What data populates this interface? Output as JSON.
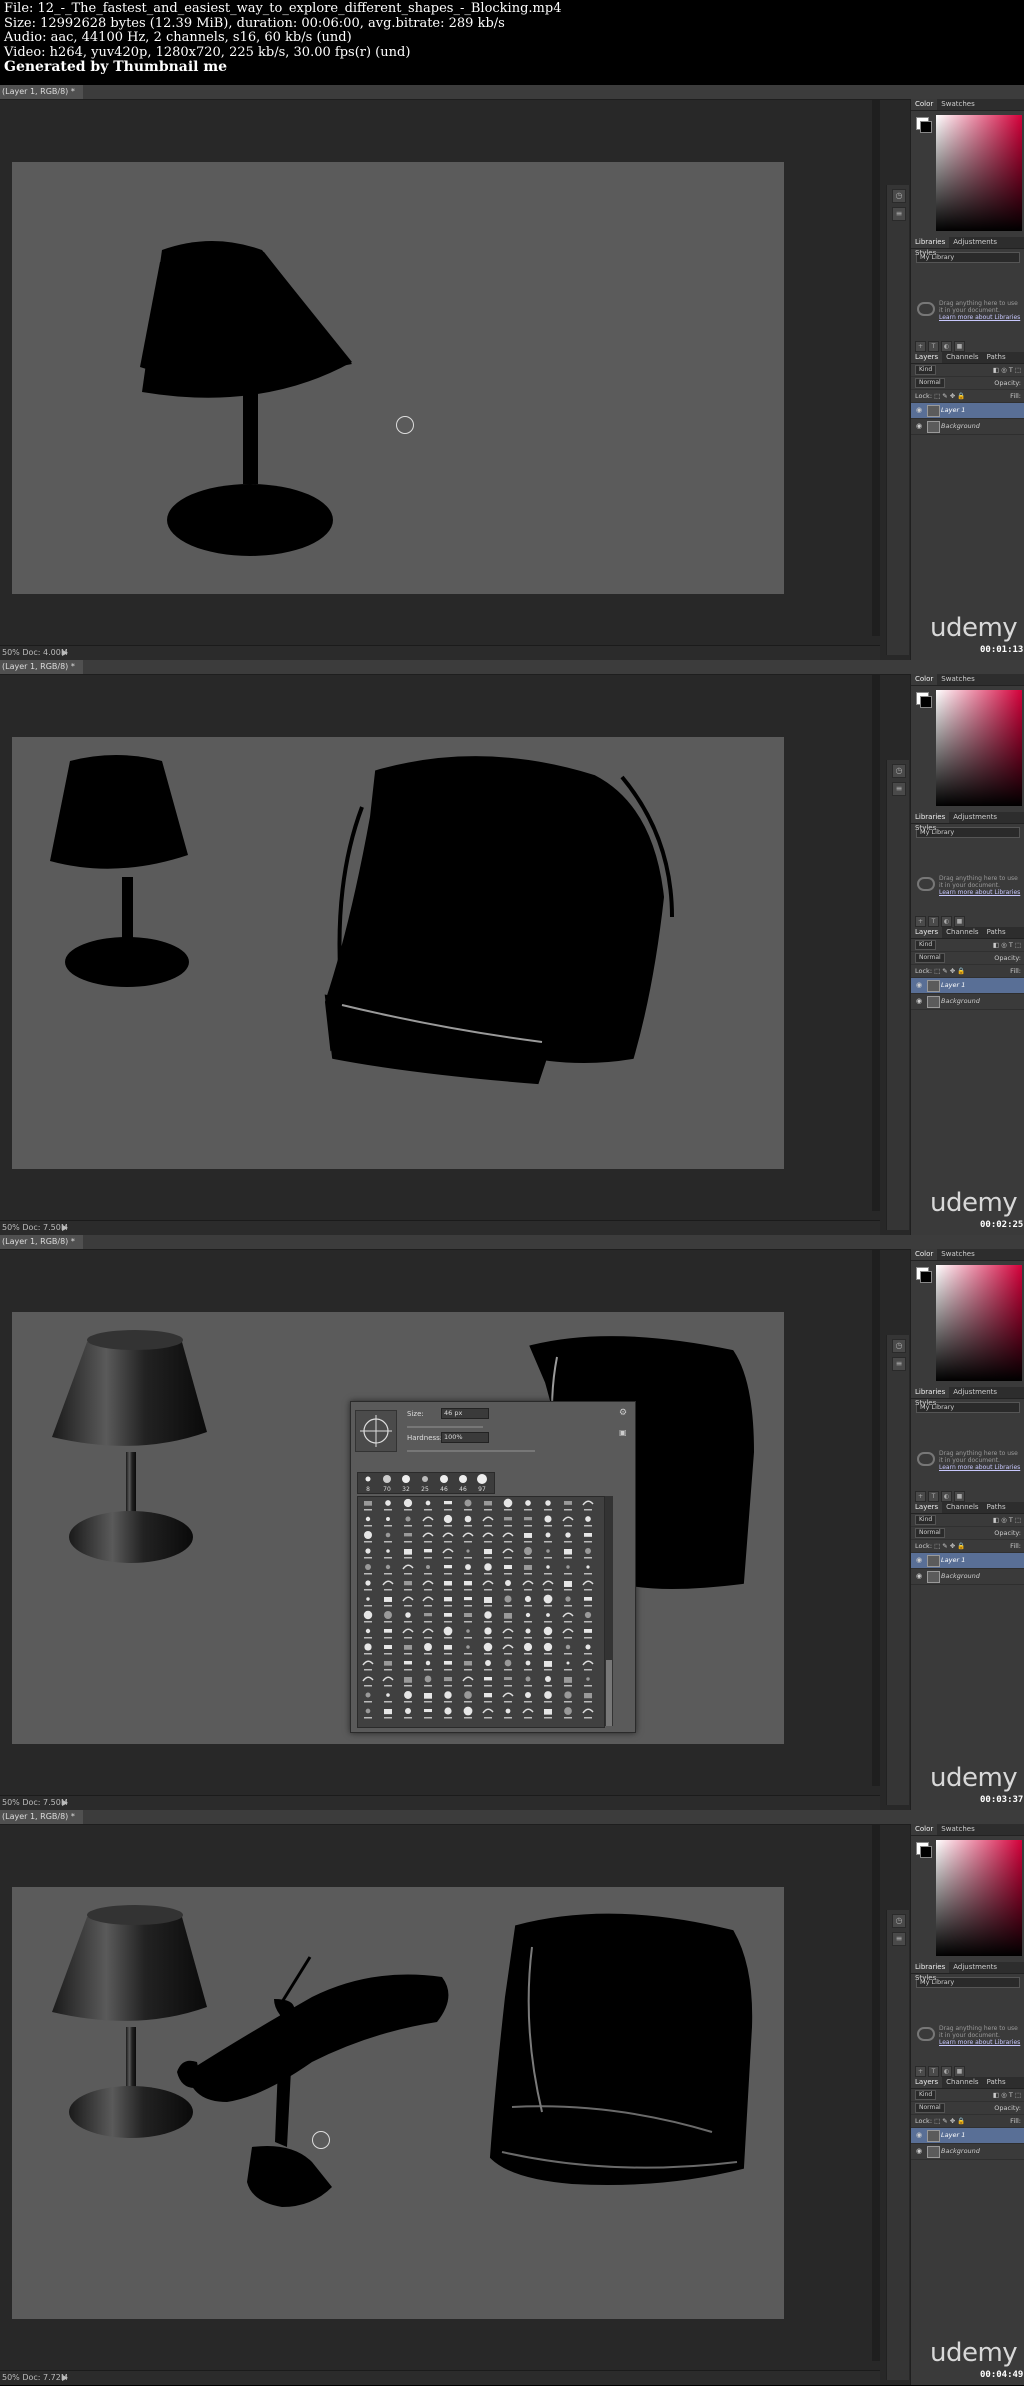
{
  "header": {
    "file_line": "File: 12_-_The_fastest_and_easiest_way_to_explore_different_shapes_-_Blocking.mp4",
    "size_line": "Size: 12992628 bytes (12.39 MiB), duration: 00:06:00, avg.bitrate: 289 kb/s",
    "audio_line": "Audio: aac, 44100 Hz, 2 channels, s16, 60 kb/s (und)",
    "video_line": "Video: h264, yuv420p, 1280x720, 225 kb/s, 30.00 fps(r) (und)",
    "generated_line": "Generated by Thumbnail me"
  },
  "frames": [
    {
      "doc_tab": "(Layer 1, RGB/8) *",
      "zoom": "50%",
      "doc_size": "Doc: 4.00M",
      "timecode": "00:01:13"
    },
    {
      "doc_tab": "(Layer 1, RGB/8) *",
      "zoom": "50%",
      "doc_size": "Doc: 7.50M",
      "timecode": "00:02:25"
    },
    {
      "doc_tab": "(Layer 1, RGB/8) *",
      "zoom": "50%",
      "doc_size": "Doc: 7.50M",
      "timecode": "00:03:37"
    },
    {
      "doc_tab": "(Layer 1, RGB/8) *",
      "zoom": "50%",
      "doc_size": "Doc: 7.72M",
      "timecode": "00:04:49"
    }
  ],
  "panel": {
    "color_tab": "Color",
    "swatches_tab": "Swatches",
    "libraries_tab": "Libraries",
    "adjustments_tab": "Adjustments",
    "styles_tab": "Styles",
    "library_select": "My Library",
    "lib_hint": "Drag anything here to use it in your document.",
    "lib_link": "Learn more about Libraries",
    "layers_tab": "Layers",
    "channels_tab": "Channels",
    "paths_tab": "Paths",
    "kind_label": "Kind",
    "blend_mode": "Normal",
    "opacity_label": "Opacity:",
    "lock_label": "Lock:",
    "fill_label": "Fill:",
    "layer1": "Layer 1",
    "background": "Background"
  },
  "brush_picker": {
    "size_label": "Size:",
    "size_value": "46 px",
    "hardness_label": "Hardness:",
    "hardness_value": "100%",
    "recent_sizes": [
      "8",
      "70",
      "32",
      "25",
      "46",
      "46",
      "97"
    ]
  },
  "watermark": "udemy",
  "colors": {
    "canvas": "#5b5b5b",
    "workspace": "#282828",
    "panel": "#3a3a3a",
    "selected_layer": "#596f96",
    "foreground": "#000000",
    "background_swatch": "#ffffff"
  }
}
